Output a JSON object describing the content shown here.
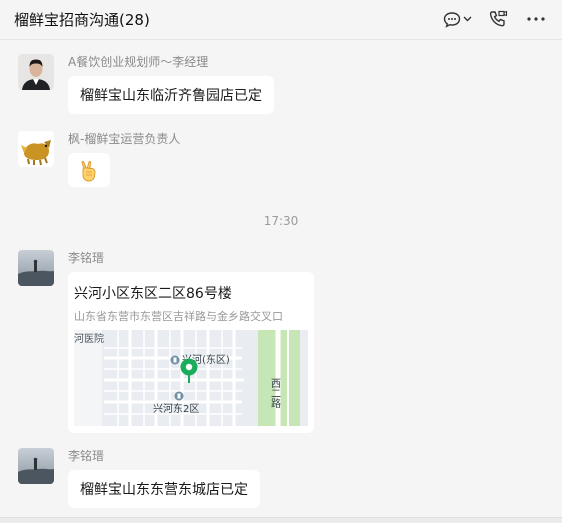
{
  "header": {
    "title": "榴鲜宝招商沟通(28)"
  },
  "messages": [
    {
      "sender": "A餐饮创业规划师～李经理",
      "text": "榴鲜宝山东临沂齐鲁园店已定"
    },
    {
      "sender": "枫-榴鲜宝运营负责人",
      "emoji": "✌️"
    },
    {
      "sender": "李铭瑨",
      "location": {
        "title": "兴河小区东区二区86号楼",
        "address": "山东省东营市东营区吉祥路与金乡路交叉口",
        "map_labels": {
          "hospital": "河医院",
          "poi_main": "兴河(东区)",
          "poi_second": "兴河东2区",
          "road": "西二路"
        }
      }
    },
    {
      "sender": "李铭瑨",
      "text": "榴鲜宝山东东营东城店已定"
    }
  ],
  "timestamp": "17:30",
  "colors": {
    "background": "#f5f5f5",
    "bubble": "#ffffff",
    "pin": "#1aad5b",
    "sender": "#8a8a8a"
  },
  "icons": [
    "chat-bubble-icon",
    "chevron-down-icon",
    "phone-video-icon",
    "more-icon",
    "map-pin-icon"
  ]
}
